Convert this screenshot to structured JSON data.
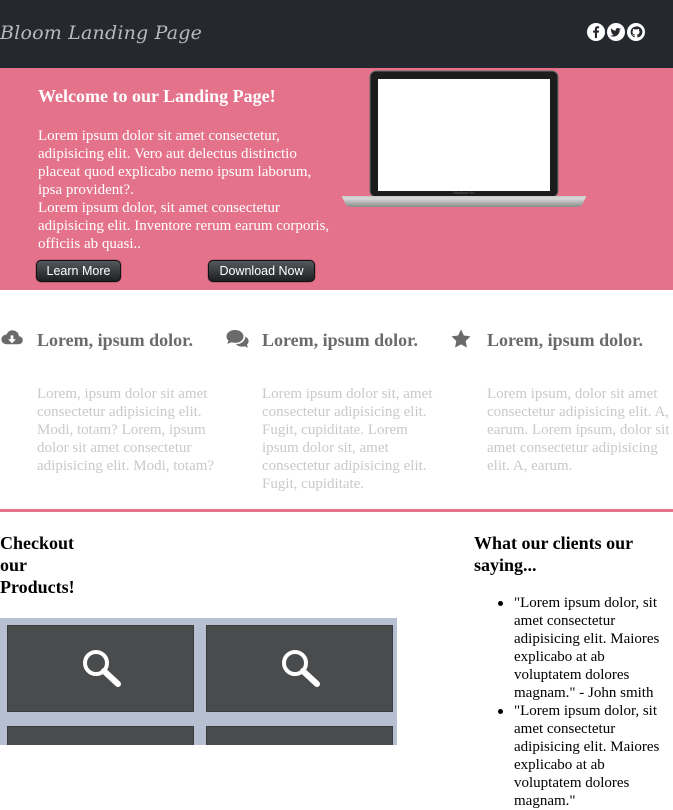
{
  "header": {
    "brand": "Bloom Landing Page",
    "social": [
      "facebook-icon",
      "twitter-icon",
      "github-icon"
    ]
  },
  "hero": {
    "title": "Welcome to our Landing Page!",
    "paragraph1": "Lorem ipsum dolor sit amet consectetur, adipisicing elit. Vero aut delectus distinctio placeat quod explicabo nemo ipsum laborum, ipsa provident?.",
    "paragraph2": "Lorem ipsum dolor, sit amet consectetur adipisicing elit. Inventore rerum earum corporis, officiis ab quasi..",
    "learn_more": "Learn More",
    "download_now": "Download Now",
    "laptop_brand": "MacBook Pro"
  },
  "features": [
    {
      "icon": "cloud-download-icon",
      "title": "Lorem, ipsum dolor.",
      "text": "Lorem, ipsum dolor sit amet consectetur adipisicing elit. Modi, totam? Lorem, ipsum dolor sit amet consectetur adipisicing elit. Modi, totam?"
    },
    {
      "icon": "comments-icon",
      "title": "Lorem, ipsum dolor.",
      "text": "Lorem ipsum dolor sit, amet consectetur adipisicing elit. Fugit, cupiditate. Lorem ipsum dolor sit, amet consectetur adipisicing elit. Fugit, cupiditate."
    },
    {
      "icon": "star-icon",
      "title": "Lorem, ipsum dolor.",
      "text": "Lorem ipsum, dolor sit amet consectetur adipisicing elit. A, earum. Lorem ipsum, dolor sit amet consectetur adipisicing elit. A, earum."
    }
  ],
  "products": {
    "title": "Checkout our Products!",
    "tile_icon": "zoom-icon"
  },
  "testimonials": {
    "title": "What our clients our saying...",
    "quotes": [
      "\"Lorem ipsum dolor, sit amet consectetur adipisicing elit. Maiores explicabo at ab voluptatem dolores magnam.\" - John smith",
      "\"Lorem ipsum dolor, sit amet consectetur adipisicing elit. Maiores explicabo at ab voluptatem dolores magnam.\""
    ]
  },
  "colors": {
    "header_bg": "#25282d",
    "accent_pink": "#e4728a",
    "muted_text": "#c9c9c9"
  }
}
